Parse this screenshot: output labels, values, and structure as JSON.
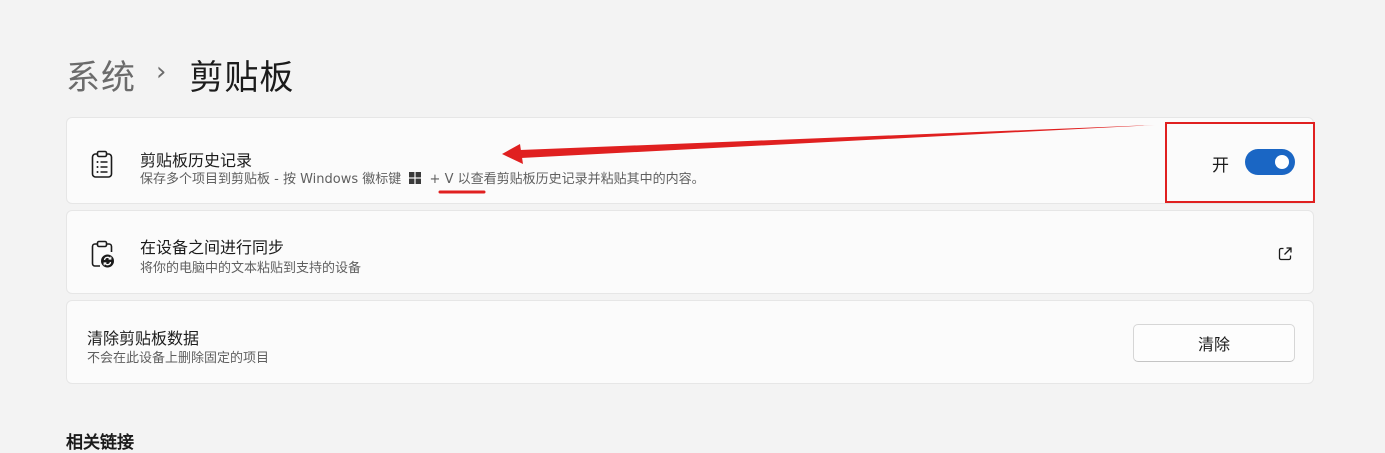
{
  "breadcrumb": {
    "parent": "系统",
    "separator": "›",
    "current": "剪贴板"
  },
  "clipboard_history": {
    "icon": "clipboard-list-icon",
    "title": "剪贴板历史记录",
    "desc_before": "保存多个项目到剪贴板 - 按 Windows 徽标键",
    "desc_key_icon": "windows-logo-icon",
    "desc_after": "+ V 以查看剪贴板历史记录并粘贴其中的内容。",
    "toggle_label": "开",
    "toggle_on": true,
    "accent_color": "#1a66c4"
  },
  "sync": {
    "icon": "clipboard-sync-icon",
    "title": "在设备之间进行同步",
    "desc": "将你的电脑中的文本粘贴到支持的设备",
    "link_icon": "external-link-icon"
  },
  "clear": {
    "title": "清除剪贴板数据",
    "desc": "不会在此设备上删除固定的项目",
    "button_label": "清除"
  },
  "related": {
    "heading": "相关链接"
  },
  "annotation_color": "#e02020"
}
